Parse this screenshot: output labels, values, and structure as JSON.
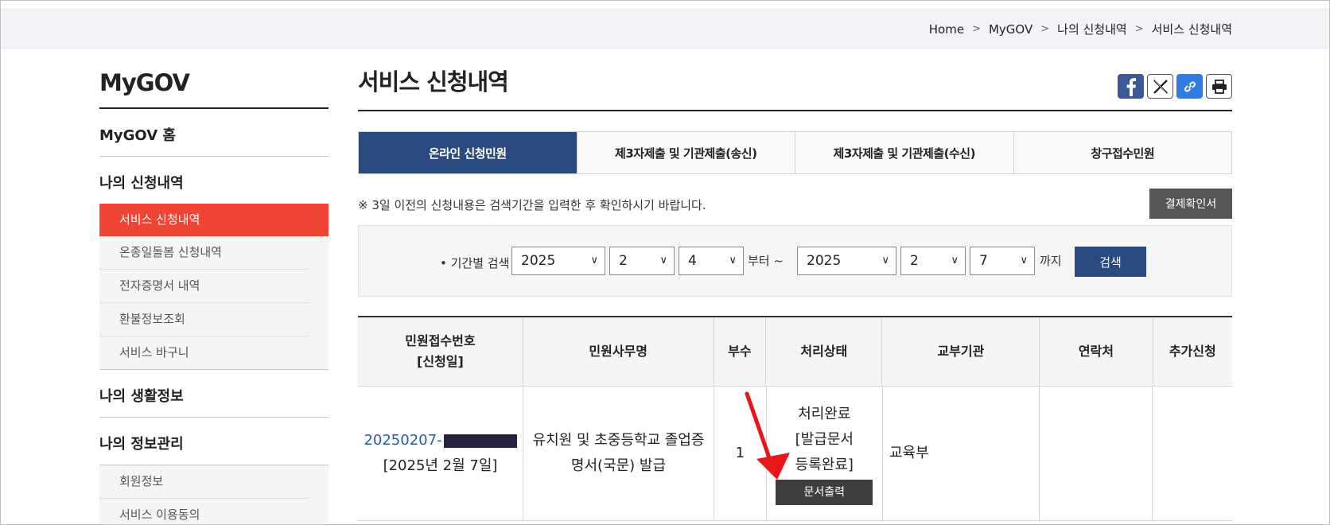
{
  "breadcrumb": [
    "Home",
    "MyGOV",
    "나의 신청내역",
    "서비스 신청내역"
  ],
  "sidebar": {
    "title": "MyGOV",
    "sections": [
      {
        "label": "MyGOV 홈"
      },
      {
        "label": "나의 신청내역",
        "items": [
          "서비스 신청내역",
          "온종일돌봄 신청내역",
          "전자증명서 내역",
          "환불정보조회",
          "서비스 바구니"
        ],
        "active": "서비스 신청내역"
      },
      {
        "label": "나의 생활정보"
      },
      {
        "label": "나의 정보관리",
        "items": [
          "회원정보",
          "서비스 이용동의"
        ]
      }
    ]
  },
  "main": {
    "title": "서비스 신청내역",
    "share_icons": [
      "facebook-icon",
      "x-icon",
      "link-icon",
      "print-icon"
    ],
    "tabs": [
      "온라인 신청민원",
      "제3자제출 및 기관제출(송신)",
      "제3자제출 및 기관제출(수신)",
      "창구접수민원"
    ],
    "active_tab": "온라인 신청민원",
    "notice": "※ 3일 이전의 신청내용은 검색기간을 입력한 후 확인하시기 바랍니다.",
    "confirm_button": "결제확인서",
    "search": {
      "label": "• 기간별 검색",
      "from_year": "2025",
      "from_month": "2",
      "from_day": "4",
      "from_word": "부터 ~",
      "to_year": "2025",
      "to_month": "2",
      "to_day": "7",
      "to_word": "까지",
      "button": "검색"
    },
    "table": {
      "headers": [
        "민원접수번호\n[신청일]",
        "민원사무명",
        "부수",
        "처리상태",
        "교부기관",
        "연락처",
        "추가신청"
      ],
      "header_1a": "민원접수번호",
      "header_1b": "[신청일]",
      "row": {
        "receipt_no": "20250207-",
        "date": "[2025년 2월 7일]",
        "service_name": "유치원 및 초중등학교 졸업증명서(국문) 발급",
        "service_line1": "유치원 및 초중등학교 졸업증",
        "service_line2": "명서(국문) 발급",
        "copies": "1",
        "status_line1": "처리완료",
        "status_line2": "[발급문서",
        "status_line3": "등록완료]",
        "print_button": "문서출력",
        "agency": "교육부",
        "contact": "",
        "additional": ""
      }
    }
  },
  "colors": {
    "accent_red": "#f04535",
    "navy": "#2a4a7f",
    "arrow_red": "#e8161b"
  }
}
